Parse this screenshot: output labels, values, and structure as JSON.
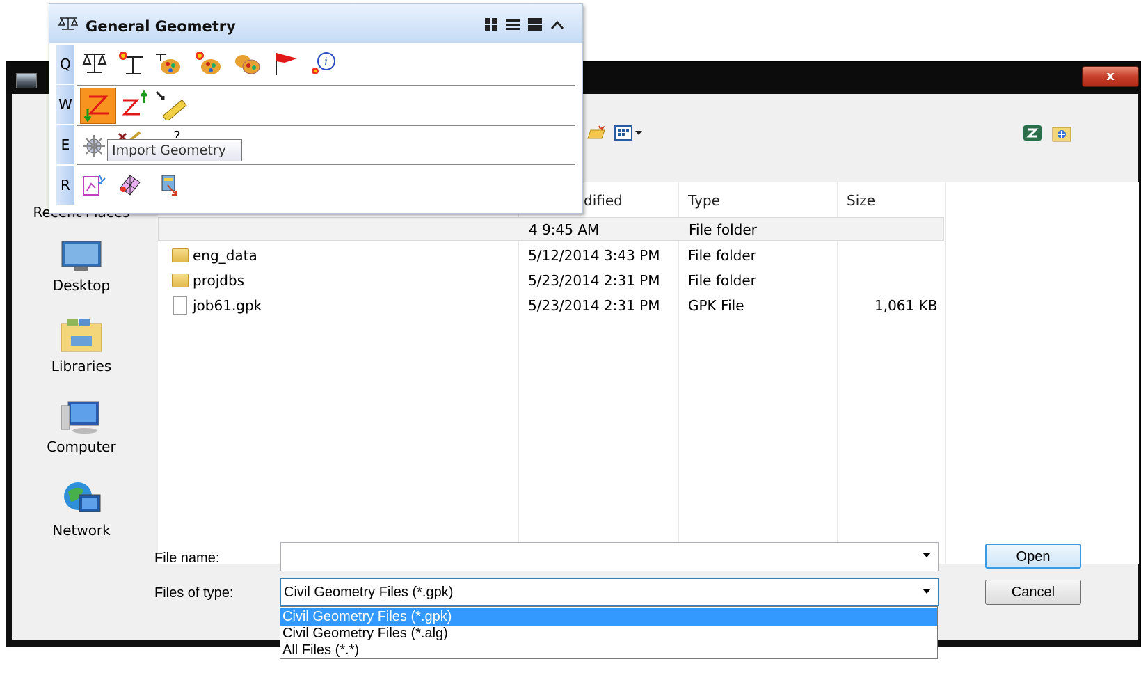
{
  "panel": {
    "title": "General Geometry",
    "row_labels": [
      "Q",
      "W",
      "E",
      "R"
    ],
    "tooltip": "Import Geometry",
    "header_icons": [
      "grid-view-icon",
      "list-view-icon",
      "full-view-icon",
      "collapse-icon"
    ]
  },
  "dialog": {
    "close_label": "x",
    "places": [
      {
        "label": "Recent Places",
        "icon": "recent-places-icon"
      },
      {
        "label": "Desktop",
        "icon": "desktop-icon"
      },
      {
        "label": "Libraries",
        "icon": "libraries-icon"
      },
      {
        "label": "Computer",
        "icon": "computer-icon"
      },
      {
        "label": "Network",
        "icon": "network-icon"
      }
    ],
    "columns": {
      "modified": "dified",
      "type": "Type",
      "size": "Size"
    },
    "files": [
      {
        "name": "",
        "date": "4 9:45 AM",
        "type": "File folder",
        "size": "",
        "icon": "folder-icon"
      },
      {
        "name": "eng_data",
        "date": "5/12/2014 3:43 PM",
        "type": "File folder",
        "size": "",
        "icon": "folder-icon"
      },
      {
        "name": "projdbs",
        "date": "5/23/2014 2:31 PM",
        "type": "File folder",
        "size": "",
        "icon": "folder-icon"
      },
      {
        "name": "job61.gpk",
        "date": "5/23/2014 2:31 PM",
        "type": "GPK File",
        "size": "1,061 KB",
        "icon": "file-icon"
      }
    ],
    "file_name_label": "File name:",
    "file_name_value": "",
    "files_of_type_label": "Files of type:",
    "files_of_type_value": "Civil Geometry Files (*.gpk)",
    "type_options": [
      "Civil Geometry Files (*.gpk)",
      "Civil Geometry Files (*.alg)",
      "All Files (*.*)"
    ],
    "open_label": "Open",
    "cancel_label": "Cancel"
  },
  "colors": {
    "selection": "#3399ff",
    "panel_header": "#c5dbf5",
    "active_tool": "#f7931e"
  }
}
